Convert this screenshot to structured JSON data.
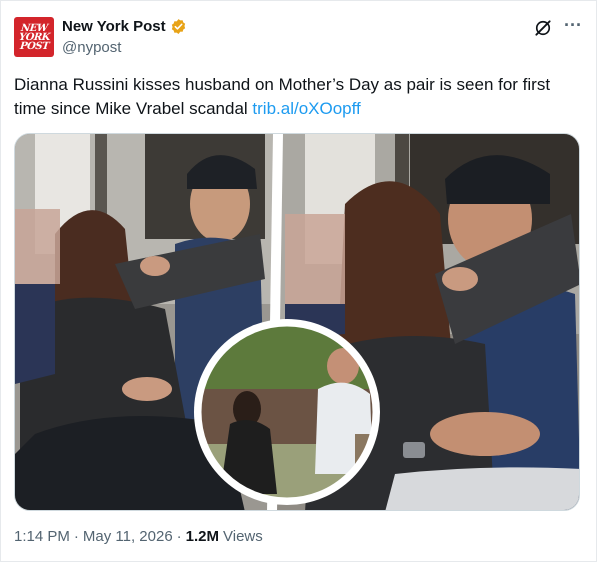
{
  "author": {
    "logo_lines": [
      "NEW",
      "YORK",
      "POST"
    ],
    "display_name": "New York Post",
    "handle": "@nypost",
    "verified_color": "#e8a317"
  },
  "tweet": {
    "text": "Dianna Russini kisses husband on Mother’s Day as pair is seen for first time since Mike Vrabel scandal ",
    "link_text": "trib.al/oXOopff"
  },
  "meta": {
    "time": "1:14 PM",
    "sep1": "·",
    "date": "May 11, 2026",
    "sep2": "·",
    "views_count": "1.2M",
    "views_label": "Views"
  },
  "colors": {
    "brand_red": "#d3252b",
    "link_blue": "#1d9bf0",
    "secondary_text": "#536471"
  }
}
